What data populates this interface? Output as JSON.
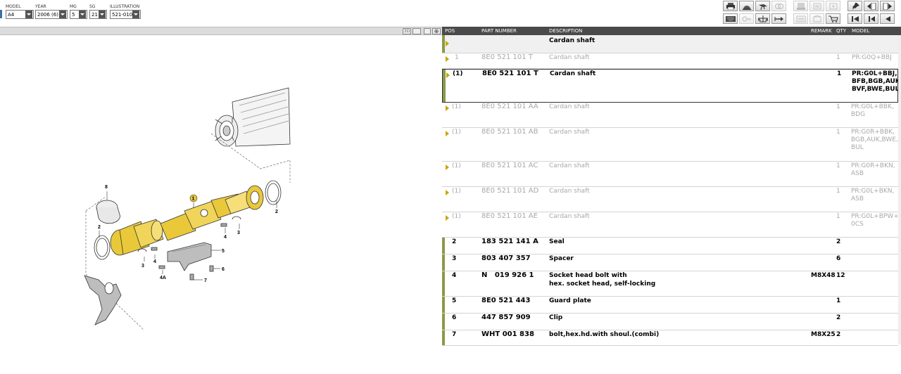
{
  "selectors": {
    "model": {
      "label": "MODEL",
      "value": "A4"
    },
    "year": {
      "label": "YEAR",
      "value": "2006 (6)"
    },
    "mg": {
      "label": "MG",
      "value": "5"
    },
    "sg": {
      "label": "SG",
      "value": "21"
    },
    "illustration": {
      "label": "ILLUSTRATION",
      "value": "521-010"
    }
  },
  "view_buttons": {
    "three_d": "3D"
  },
  "columns": {
    "pos": "POS",
    "part_number": "PART NUMBER",
    "description": "DESCRIPTION",
    "remark": "REMARK",
    "qty": "QTY",
    "model": "MODEL"
  },
  "parts": [
    {
      "pos": "",
      "part": "",
      "desc": "Cardan shaft",
      "desc2": "",
      "remark": "",
      "qty": "",
      "model": ""
    },
    {
      "pos": "1",
      "part": "8E0 521 101 T",
      "desc": "Cardan shaft",
      "desc2": "",
      "remark": "",
      "qty": "1",
      "model": "PR:G0Q+BBJ"
    },
    {
      "pos": "(1)",
      "part": "8E0 521 101 T",
      "desc": "Cardan shaft",
      "desc2": "",
      "remark": "",
      "qty": "1",
      "model": "PR:G0L+BBJ,\nBFB,BGB,AUK,\nBVF,BWE,BUL"
    },
    {
      "pos": "(1)",
      "part": "8E0 521 101 AA",
      "desc": "Cardan shaft",
      "desc2": "",
      "remark": "",
      "qty": "1",
      "model": "PR:G0L+BBK,\nBDG"
    },
    {
      "pos": "(1)",
      "part": "8E0 521 101 AB",
      "desc": "Cardan shaft",
      "desc2": "",
      "remark": "",
      "qty": "1",
      "model": "PR:G0R+BBK,\nBGB,AUK,BWE,\nBUL"
    },
    {
      "pos": "(1)",
      "part": "8E0 521 101 AC",
      "desc": "Cardan shaft",
      "desc2": "",
      "remark": "",
      "qty": "1",
      "model": "PR:G0R+BKN,\nASB"
    },
    {
      "pos": "(1)",
      "part": "8E0 521 101 AD",
      "desc": "Cardan shaft",
      "desc2": "",
      "remark": "",
      "qty": "1",
      "model": "PR:G0L+BKN,\nASB"
    },
    {
      "pos": "(1)",
      "part": "8E0 521 101 AE",
      "desc": "Cardan shaft",
      "desc2": "",
      "remark": "",
      "qty": "1",
      "model": "PR:G0L+BPW+\n0CS"
    },
    {
      "pos": "2",
      "part": "183 521 141 A",
      "desc": "Seal",
      "desc2": "",
      "remark": "",
      "qty": "2",
      "model": ""
    },
    {
      "pos": "3",
      "part": "803 407 357",
      "desc": "Spacer",
      "desc2": "",
      "remark": "",
      "qty": "6",
      "model": ""
    },
    {
      "pos": "4",
      "part": "N   019 926 1",
      "desc": "Socket head bolt with",
      "desc2": "hex. socket head, self-locking",
      "remark": "M8X48",
      "qty": "12",
      "model": ""
    },
    {
      "pos": "5",
      "part": "8E0 521 443",
      "desc": "Guard plate",
      "desc2": "",
      "remark": "",
      "qty": "1",
      "model": ""
    },
    {
      "pos": "6",
      "part": "447 857 909",
      "desc": "Clip",
      "desc2": "",
      "remark": "",
      "qty": "2",
      "model": ""
    },
    {
      "pos": "7",
      "part": "WHT 001 838",
      "desc": "bolt,hex.hd.with shoul.(combi)",
      "desc2": "",
      "remark": "M8X25",
      "qty": "2",
      "model": ""
    }
  ],
  "callouts": {
    "c1": "1",
    "c2a": "2",
    "c2b": "2",
    "c3a": "3",
    "c3b": "3",
    "c4a": "4",
    "c4b": "4",
    "c4A": "4A",
    "c5": "5",
    "c6": "6",
    "c7": "7",
    "c8": "8"
  },
  "colors": {
    "accent_bar": "#8a9a48",
    "triangle": "#c9a400",
    "highlight": "#e9c83a"
  }
}
